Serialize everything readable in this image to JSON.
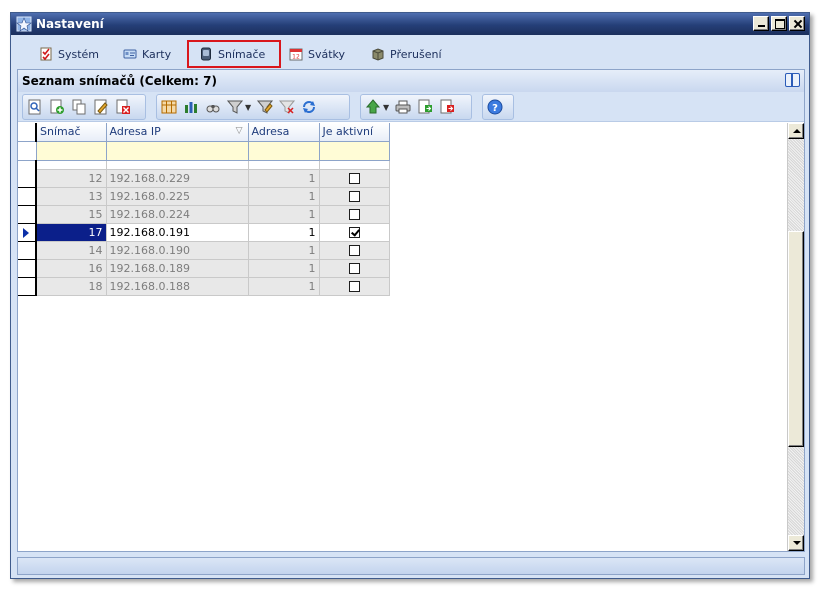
{
  "window": {
    "title": "Nastavení"
  },
  "tabs": [
    {
      "label": "Systém",
      "icon": "checklist-icon"
    },
    {
      "label": "Karty",
      "icon": "card-icon"
    },
    {
      "label": "Snímače",
      "icon": "reader-icon",
      "active": true
    },
    {
      "label": "Svátky",
      "icon": "calendar-icon"
    },
    {
      "label": "Přerušení",
      "icon": "box-icon"
    }
  ],
  "panel": {
    "title": "Seznam snímačů (Celkem: 7)"
  },
  "grid": {
    "columns": [
      "Snímač",
      "Adresa IP",
      "Adresa",
      "Je aktivní"
    ],
    "rows": [
      {
        "id": "12",
        "ip": "192.168.0.229",
        "addr": "1",
        "active": false,
        "current": false
      },
      {
        "id": "13",
        "ip": "192.168.0.225",
        "addr": "1",
        "active": false,
        "current": false
      },
      {
        "id": "15",
        "ip": "192.168.0.224",
        "addr": "1",
        "active": false,
        "current": false
      },
      {
        "id": "17",
        "ip": "192.168.0.191",
        "addr": "1",
        "active": true,
        "current": true
      },
      {
        "id": "14",
        "ip": "192.168.0.190",
        "addr": "1",
        "active": false,
        "current": false
      },
      {
        "id": "16",
        "ip": "192.168.0.189",
        "addr": "1",
        "active": false,
        "current": false
      },
      {
        "id": "18",
        "ip": "192.168.0.188",
        "addr": "1",
        "active": false,
        "current": false
      }
    ]
  },
  "colors": {
    "accent": "#1c2f5c",
    "selection": "#0b1f8a",
    "active_tab_border": "#d9161c"
  }
}
